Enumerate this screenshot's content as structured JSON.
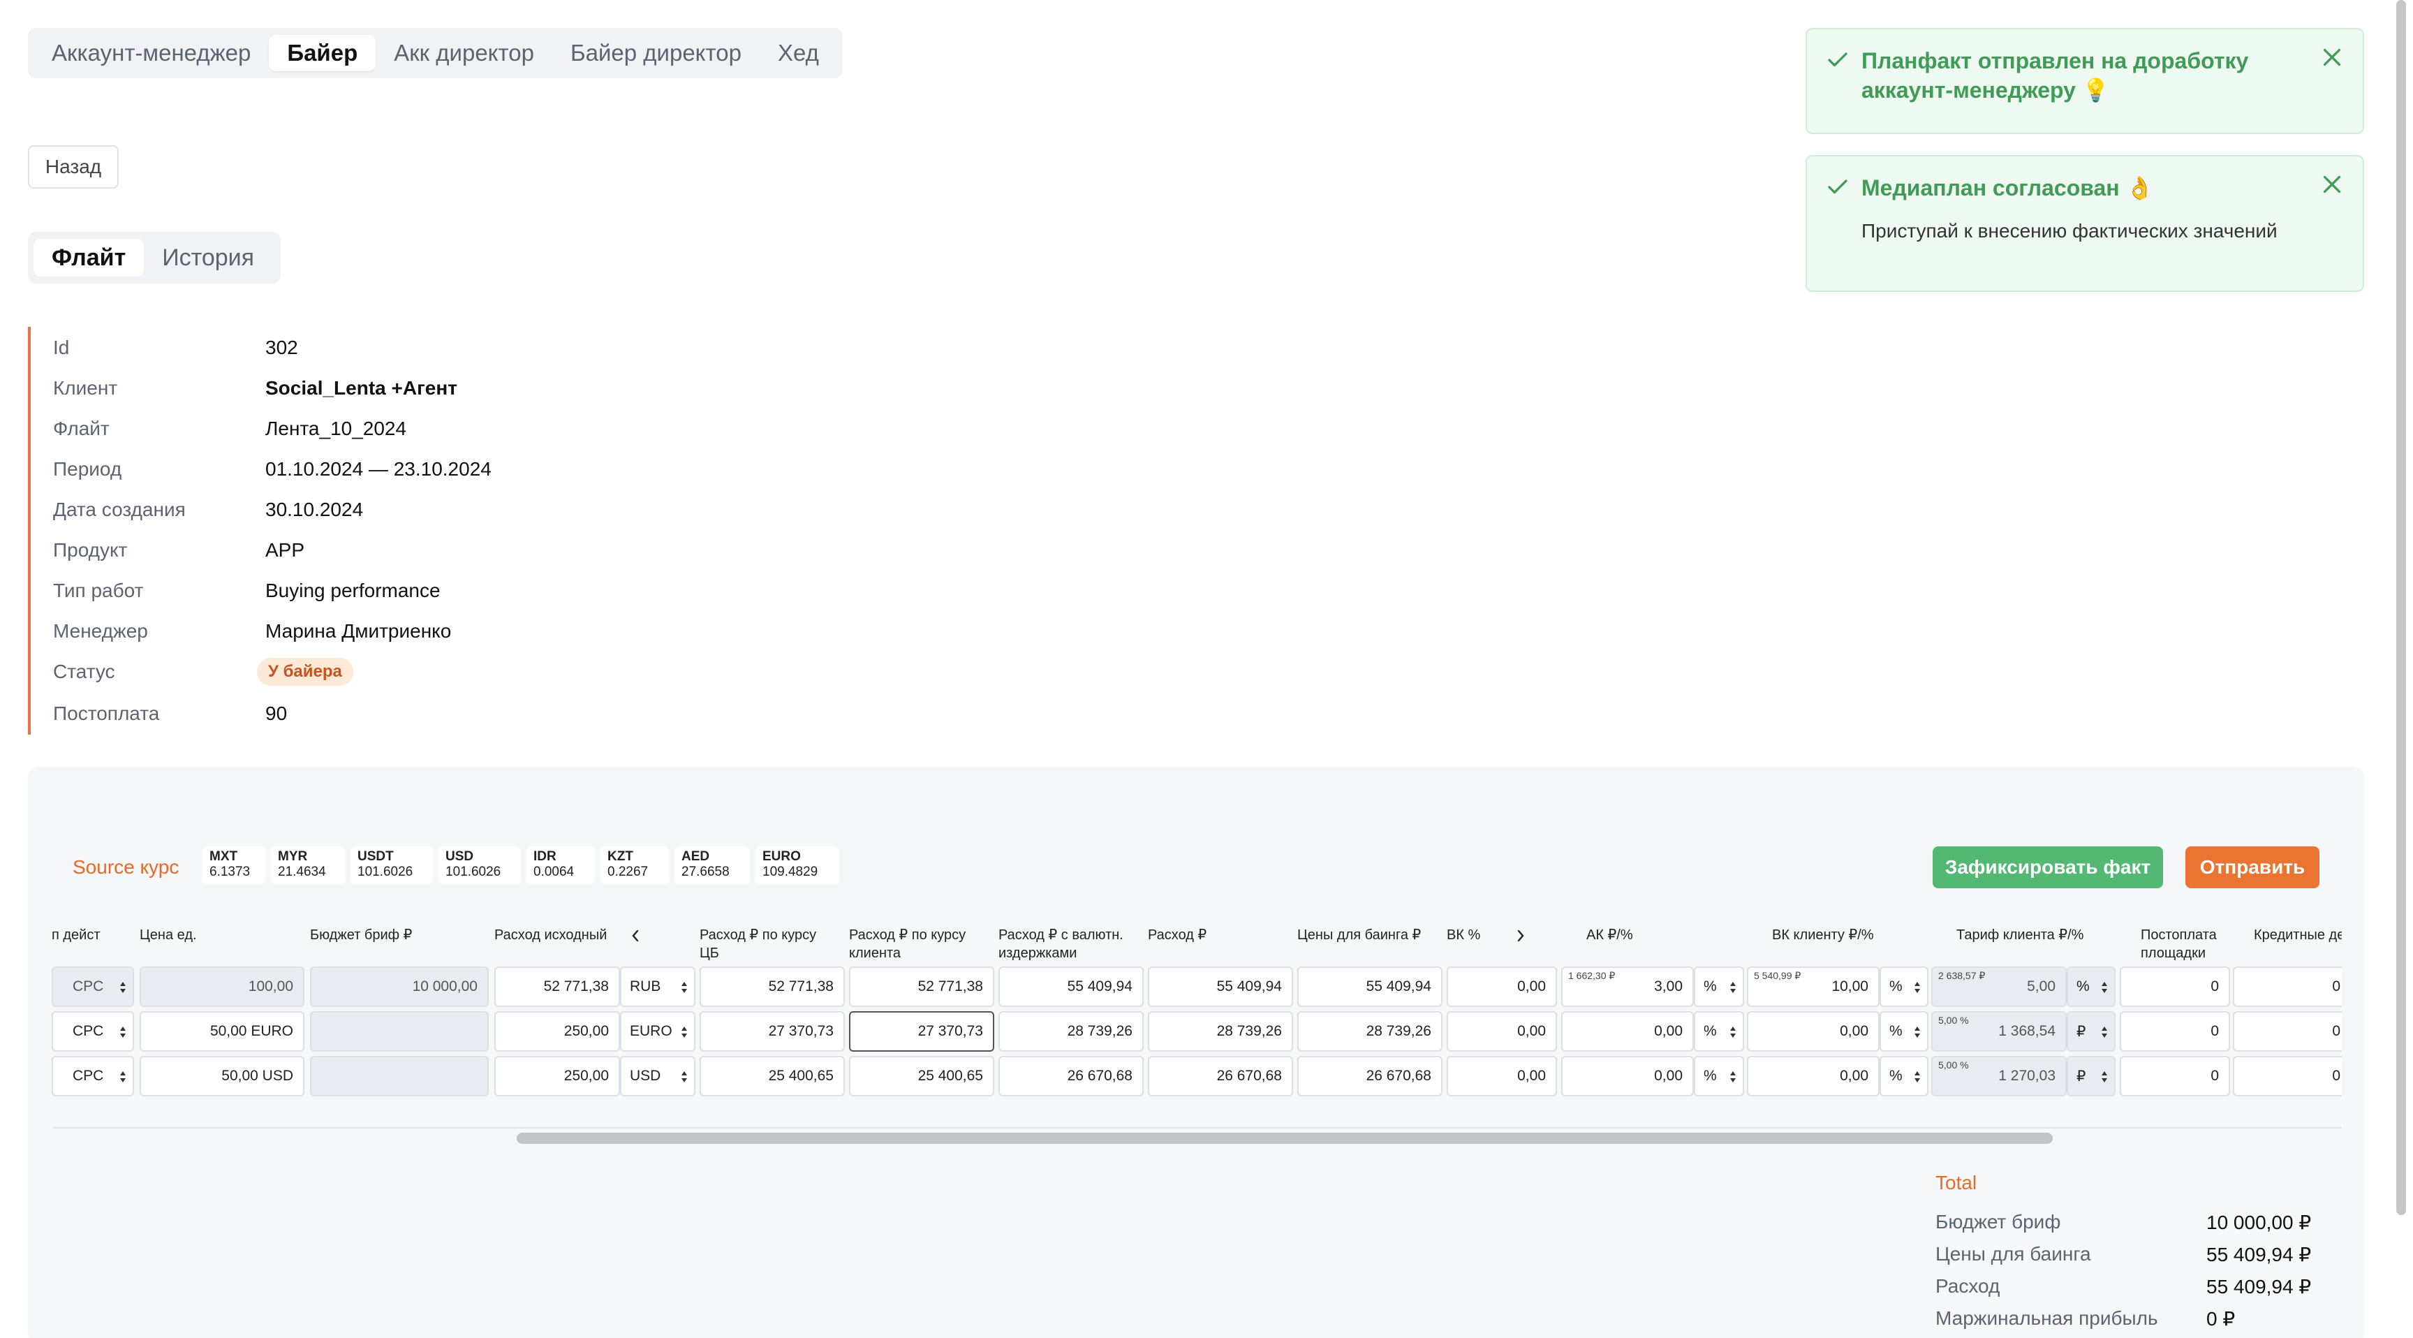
{
  "role_tabs": [
    "Аккаунт-менеджер",
    "Байер",
    "Акк директор",
    "Байер директор",
    "Хед"
  ],
  "back_label": "Назад",
  "sub_tabs": [
    "Флайт",
    "История"
  ],
  "info": {
    "id_label": "Id",
    "id_value": "302",
    "client_label": "Клиент",
    "client_value": "Social_Lenta +Агент",
    "flight_label": "Флайт",
    "flight_value": "Лента_10_2024",
    "period_label": "Период",
    "period_value": "01.10.2024 — 23.10.2024",
    "created_label": "Дата создания",
    "created_value": "30.10.2024",
    "product_label": "Продукт",
    "product_value": "APP",
    "worktype_label": "Тип работ",
    "worktype_value": "Buying performance",
    "manager_label": "Менеджер",
    "manager_value": "Марина Дмитриенко",
    "status_label": "Статус",
    "status_value": "У байера",
    "postpay_label": "Постоплата",
    "postpay_value": "90"
  },
  "toasts": [
    {
      "title": "Планфакт отправлен на доработку аккаунт-менеджеру 💡",
      "body": ""
    },
    {
      "title": "Медиаплан согласован 👌",
      "body": "Приступай к внесению фактических значений"
    }
  ],
  "source_label": "Source курс",
  "rates": [
    {
      "code": "MXT",
      "value": "6.1373"
    },
    {
      "code": "MYR",
      "value": "21.4634"
    },
    {
      "code": "USDT",
      "value": "101.6026"
    },
    {
      "code": "USD",
      "value": "101.6026"
    },
    {
      "code": "IDR",
      "value": "0.0064"
    },
    {
      "code": "KZT",
      "value": "0.2267"
    },
    {
      "code": "AED",
      "value": "27.6658"
    },
    {
      "code": "EURO",
      "value": "109.4829"
    }
  ],
  "fix_button": "Зафиксировать факт",
  "send_button": "Отправить",
  "columns": {
    "action": "п дейст",
    "unit_price": "Цена ед.",
    "brief_budget": "Бюджет бриф ₽",
    "source_spend": "Расход исходный",
    "spend_cb_1": "Расход ₽ по курсу",
    "spend_cb_2": "ЦБ",
    "spend_client_1": "Расход ₽ по курсу",
    "spend_client_2": "клиента",
    "spend_fx_1": "Расход ₽ с валютн.",
    "spend_fx_2": "издержками",
    "spend": "Расход ₽",
    "buying_price": "Цены для баинга ₽",
    "vk_pct": "ВК %",
    "ak": "АК ₽/%",
    "vk_client": "ВК клиенту ₽/%",
    "client_tariff": "Тариф клиента ₽/%",
    "site_postpay_1": "Постоплата",
    "site_postpay_2": "площадки",
    "credit_days": "Кредитные день"
  },
  "rows": [
    {
      "action": "CPC",
      "unit_price": "100,00",
      "brief_budget": "10 000,00",
      "source_spend": "52 771,38",
      "currency": "RUB",
      "spend_cb": "52 771,38",
      "spend_client": "52 771,38",
      "spend_fx": "55 409,94",
      "spend": "55 409,94",
      "buying_price": "55 409,94",
      "vk_pct": "0,00",
      "ak_hint": "1 662,30 ₽",
      "ak_value": "3,00",
      "ak_unit": "%",
      "vk_client_hint": "5 540,99 ₽",
      "vk_client_value": "10,00",
      "vk_client_unit": "%",
      "tariff_hint": "2 638,57 ₽",
      "tariff_value": "5,00",
      "tariff_unit": "%",
      "site_postpay": "0",
      "credit_days": "0"
    },
    {
      "action": "CPC",
      "unit_price": "50,00 EURO",
      "brief_budget": "",
      "source_spend": "250,00",
      "currency": "EURO",
      "spend_cb": "27 370,73",
      "spend_client": "27 370,73",
      "spend_fx": "28 739,26",
      "spend": "28 739,26",
      "buying_price": "28 739,26",
      "vk_pct": "0,00",
      "ak_hint": "",
      "ak_value": "0,00",
      "ak_unit": "%",
      "vk_client_hint": "",
      "vk_client_value": "0,00",
      "vk_client_unit": "%",
      "tariff_hint": "5,00 %",
      "tariff_value": "1 368,54",
      "tariff_unit": "₽",
      "site_postpay": "0",
      "credit_days": "0"
    },
    {
      "action": "CPC",
      "unit_price": "50,00 USD",
      "brief_budget": "",
      "source_spend": "250,00",
      "currency": "USD",
      "spend_cb": "25 400,65",
      "spend_client": "25 400,65",
      "spend_fx": "26 670,68",
      "spend": "26 670,68",
      "buying_price": "26 670,68",
      "vk_pct": "0,00",
      "ak_hint": "",
      "ak_value": "0,00",
      "ak_unit": "%",
      "vk_client_hint": "",
      "vk_client_value": "0,00",
      "vk_client_unit": "%",
      "tariff_hint": "5,00 %",
      "tariff_value": "1 270,03",
      "tariff_unit": "₽",
      "site_postpay": "0",
      "credit_days": "0"
    }
  ],
  "total": {
    "title": "Total",
    "brief_label": "Бюджет бриф",
    "brief_value": "10 000,00 ₽",
    "buying_label": "Цены для баинга",
    "buying_value": "55 409,94 ₽",
    "spend_label": "Расход",
    "spend_value": "55 409,94 ₽",
    "margin_label": "Маржинальная прибыль",
    "margin_value": "0 ₽"
  },
  "colors": {
    "accent_orange": "#e56a2b",
    "success_green": "#52b872",
    "send_orange": "#ea7431"
  }
}
